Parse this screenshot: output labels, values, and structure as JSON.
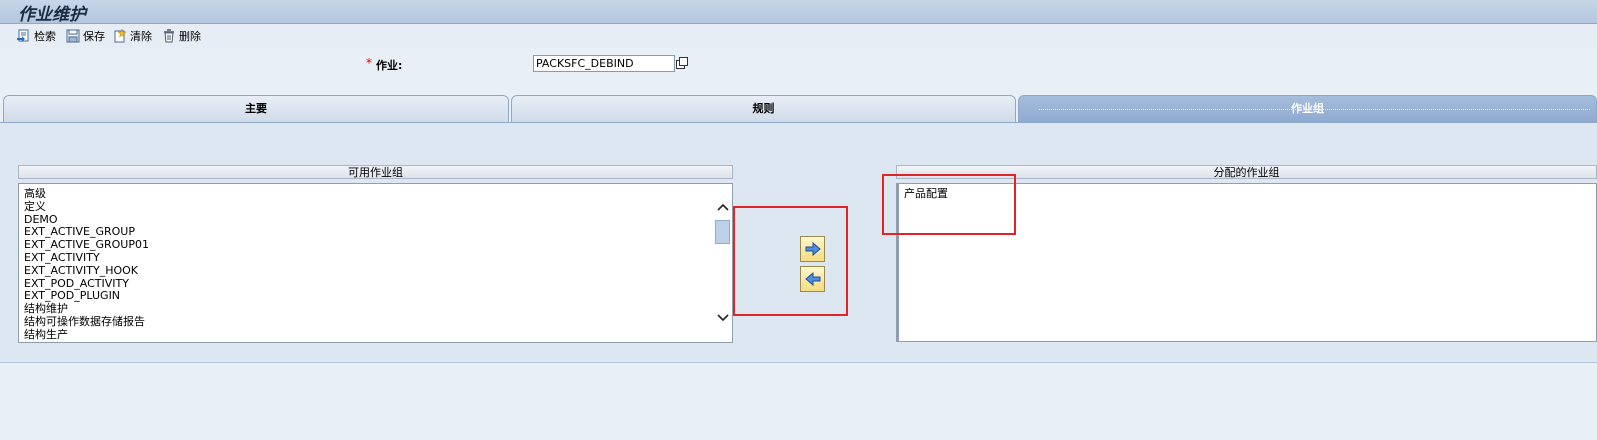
{
  "window": {
    "title": "作业维护"
  },
  "toolbar": {
    "retrieve_label": "检索",
    "save_label": "保存",
    "clear_label": "清除",
    "delete_label": "删除"
  },
  "form": {
    "required_marker": "*",
    "job_label": "作业:",
    "job_value": "PACKSFC_DEBIND"
  },
  "tabs": [
    {
      "label": "主要",
      "active": false
    },
    {
      "label": "规则",
      "active": false
    },
    {
      "label": "作业组",
      "active": true
    }
  ],
  "available_groups": {
    "header": "可用作业组",
    "items": [
      "高级",
      "定义",
      "DEMO",
      "EXT_ACTIVE_GROUP",
      "EXT_ACTIVE_GROUP01",
      "EXT_ACTIVITY",
      "EXT_ACTIVITY_HOOK",
      "EXT_POD_ACTIVITY",
      "EXT_POD_PLUGIN",
      "结构维护",
      "结构可操作数据存储报告",
      "结构生产"
    ]
  },
  "assigned_groups": {
    "header": "分配的作业组",
    "items": [
      "产品配置"
    ]
  },
  "colors": {
    "highlight": "#e32424",
    "active_tab": "#8eaad0",
    "move_button": "#f5dc80"
  },
  "icons": {
    "retrieve": "retrieve-icon",
    "save": "save-icon",
    "clear": "clear-icon",
    "delete": "delete-icon",
    "browse": "browse-icon",
    "move_right": "arrow-right-icon",
    "move_left": "arrow-left-icon"
  }
}
